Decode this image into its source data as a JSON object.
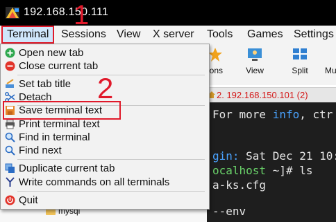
{
  "window": {
    "title": "192.168.150.111"
  },
  "menubar": {
    "items": [
      "Terminal",
      "Sessions",
      "View",
      "X server",
      "Tools",
      "Games",
      "Settings"
    ]
  },
  "toolbar": {
    "items": [
      "ions",
      "View",
      "Split",
      "Mu"
    ]
  },
  "tab": {
    "label": "2. 192.168.150.101 (2)"
  },
  "terminal": {
    "lines": [
      {
        "text": "For more info, ctr",
        "color": "#e6e6e6"
      },
      {
        "text": "gin: Sat Dec 21 10:",
        "color": "#e6e6e6"
      },
      {
        "text": "ocalhost ~]# ls",
        "color": "#e6e6e6"
      },
      {
        "text": "a-ks.cfg",
        "color": "#e6e6e6"
      },
      {
        "text": "--env",
        "color": "#e6e6e6"
      }
    ],
    "info_word": "info"
  },
  "terminal_menu": {
    "items": [
      {
        "label": "Open new tab",
        "icon": "plus-circle-icon"
      },
      {
        "label": "Close current tab",
        "icon": "minus-circle-icon"
      },
      {
        "label": "Set tab title",
        "icon": "rename-icon"
      },
      {
        "label": "Detach",
        "icon": "scissors-icon"
      },
      {
        "label": "Save terminal text",
        "icon": "save-icon"
      },
      {
        "label": "Print terminal text",
        "icon": "printer-icon"
      },
      {
        "label": "Find in terminal",
        "icon": "search-icon"
      },
      {
        "label": "Find next",
        "icon": "search-next-icon"
      },
      {
        "label": "Duplicate current tab",
        "icon": "duplicate-icon"
      },
      {
        "label": "Write commands on all terminals",
        "icon": "fork-icon"
      },
      {
        "label": "Quit",
        "icon": "power-icon"
      }
    ]
  },
  "sidebar": {
    "folder": "mysql"
  },
  "annotations": {
    "one": "1",
    "two": "2"
  },
  "colors": {
    "annotation_red": "#e0192a",
    "highlight_blue": "#cfe6fb",
    "terminal_bg": "#1e1e1e",
    "prompt_blue": "#4aa3ff",
    "prompt_green": "#6ad36a"
  }
}
